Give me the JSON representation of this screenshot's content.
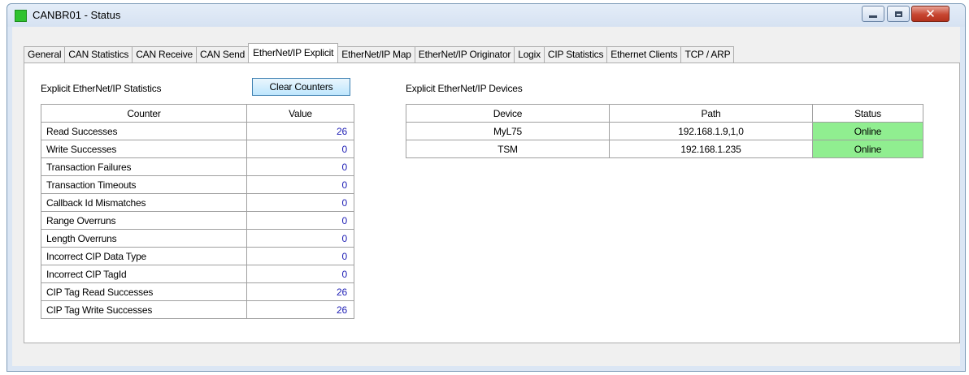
{
  "window": {
    "title": "CANBR01 - Status",
    "icon": "green-square-icon",
    "controls": {
      "minimize": "minimize-icon",
      "maximize": "maximize-icon",
      "close": "close-icon"
    }
  },
  "tabs": [
    {
      "label": "General",
      "active": false
    },
    {
      "label": "CAN Statistics",
      "active": false
    },
    {
      "label": "CAN Receive",
      "active": false
    },
    {
      "label": "CAN Send",
      "active": false
    },
    {
      "label": "EtherNet/IP Explicit",
      "active": true
    },
    {
      "label": "EtherNet/IP Map",
      "active": false
    },
    {
      "label": "EtherNet/IP Originator",
      "active": false
    },
    {
      "label": "Logix",
      "active": false
    },
    {
      "label": "CIP Statistics",
      "active": false
    },
    {
      "label": "Ethernet Clients",
      "active": false
    },
    {
      "label": "TCP / ARP",
      "active": false
    }
  ],
  "stats": {
    "heading": "Explicit EtherNet/IP Statistics",
    "clear_button": "Clear Counters",
    "columns": [
      "Counter",
      "Value"
    ],
    "rows": [
      {
        "counter": "Read Successes",
        "value": "26"
      },
      {
        "counter": "Write Successes",
        "value": "0"
      },
      {
        "counter": "Transaction Failures",
        "value": "0"
      },
      {
        "counter": "Transaction Timeouts",
        "value": "0"
      },
      {
        "counter": "Callback Id Mismatches",
        "value": "0"
      },
      {
        "counter": "Range Overruns",
        "value": "0"
      },
      {
        "counter": "Length Overruns",
        "value": "0"
      },
      {
        "counter": "Incorrect CIP Data Type",
        "value": "0"
      },
      {
        "counter": "Incorrect CIP TagId",
        "value": "0"
      },
      {
        "counter": "CIP Tag Read Successes",
        "value": "26"
      },
      {
        "counter": "CIP Tag Write Successes",
        "value": "26"
      }
    ]
  },
  "devices": {
    "heading": "Explicit EtherNet/IP Devices",
    "columns": [
      "Device",
      "Path",
      "Status"
    ],
    "rows": [
      {
        "device": "MyL75",
        "path": "192.168.1.9,1,0",
        "status": "Online"
      },
      {
        "device": "TSM",
        "path": "192.168.1.235",
        "status": "Online"
      }
    ]
  },
  "colors": {
    "online": "#90ee90",
    "value_text": "#1f1fb5",
    "app_icon": "#2fc22f",
    "close_button": "#c74631"
  }
}
